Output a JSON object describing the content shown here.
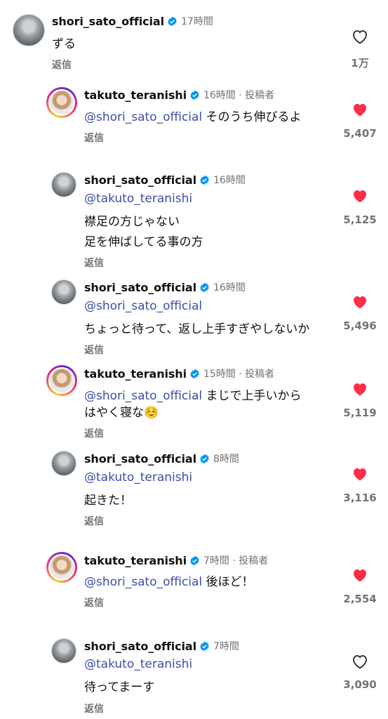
{
  "comments": [
    {
      "user": "shori_sato_official",
      "time": "17時間",
      "lines": [
        "ずる"
      ],
      "reply": "返信",
      "likes": "1万",
      "liked": false
    },
    {
      "user": "takuto_teranishi",
      "time": "16時間 · 投稿者",
      "mention": "@shori_sato_official",
      "lines": [
        "そのうち伸びるよ"
      ],
      "reply": "返信",
      "likes": "5,407",
      "liked": true
    },
    {
      "user": "shori_sato_official",
      "time": "16時間",
      "mention": "@takuto_teranishi",
      "lines": [
        "襟足の方じゃない",
        "足を伸ばしてる事の方"
      ],
      "reply": "返信",
      "likes": "5,125",
      "liked": true
    },
    {
      "user": "shori_sato_official",
      "time": "16時間",
      "mention": "@shori_sato_official",
      "lines": [
        "ちょっと待って、返し上手すぎやしないか"
      ],
      "reply": "返信",
      "likes": "5,496",
      "liked": true
    },
    {
      "user": "takuto_teranishi",
      "time": "15時間 · 投稿者",
      "mention": "@shori_sato_official",
      "lines": [
        "まじで上手いから",
        "はやく寝な☺️"
      ],
      "reply": "返信",
      "likes": "5,119",
      "liked": true
    },
    {
      "user": "shori_sato_official",
      "time": "8時間",
      "mention": "@takuto_teranishi",
      "lines": [
        "起きた！"
      ],
      "reply": "返信",
      "likes": "3,116",
      "liked": true
    },
    {
      "user": "takuto_teranishi",
      "time": "7時間 · 投稿者",
      "mention": "@shori_sato_official",
      "lines": [
        "後ほど！"
      ],
      "reply": "返信",
      "likes": "2,554",
      "liked": true
    },
    {
      "user": "shori_sato_official",
      "time": "7時間",
      "mention": "@takuto_teranishi",
      "lines": [
        "待ってまーす"
      ],
      "reply": "返信",
      "likes": "3,090",
      "liked": false
    }
  ],
  "colors": {
    "heart_liked": "#ff2d47",
    "mention": "#3b4fa8",
    "verified": "#0095f6"
  }
}
